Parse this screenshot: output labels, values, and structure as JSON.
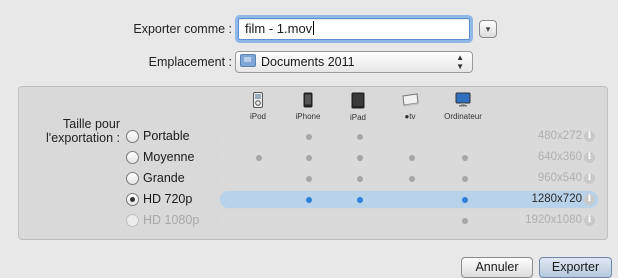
{
  "export_as": {
    "label": "Exporter comme :",
    "value": "film - 1.mov",
    "disclosure": "▾"
  },
  "location": {
    "label": "Emplacement :",
    "value": "Documents 2011",
    "folder_icon": "folder-icon"
  },
  "size": {
    "label_line1": "Taille pour",
    "label_line2": "l'exportation :",
    "devices": [
      {
        "name": "iPod",
        "icon": "ipod-icon"
      },
      {
        "name": "iPhone",
        "icon": "iphone-icon"
      },
      {
        "name": "iPad",
        "icon": "ipad-icon"
      },
      {
        "name": "tv",
        "icon": "appletv-icon"
      },
      {
        "name": "Ordinateur",
        "icon": "computer-icon"
      }
    ],
    "options": [
      {
        "label": "Portable",
        "resolution": "480x272",
        "selected": false,
        "enabled": true,
        "compat": [
          false,
          true,
          true,
          false,
          false
        ]
      },
      {
        "label": "Moyenne",
        "resolution": "640x360",
        "selected": false,
        "enabled": true,
        "compat": [
          true,
          true,
          true,
          true,
          true
        ]
      },
      {
        "label": "Grande",
        "resolution": "960x540",
        "selected": false,
        "enabled": true,
        "compat": [
          false,
          true,
          true,
          true,
          true
        ]
      },
      {
        "label": "HD 720p",
        "resolution": "1280x720",
        "selected": true,
        "enabled": true,
        "compat": [
          false,
          true,
          true,
          false,
          true
        ]
      },
      {
        "label": "HD 1080p",
        "resolution": "1920x1080",
        "selected": false,
        "enabled": false,
        "compat": [
          false,
          false,
          false,
          false,
          true
        ]
      }
    ]
  },
  "buttons": {
    "cancel": "Annuler",
    "export": "Exporter"
  },
  "colors": {
    "selected_row": "#b8d2ea",
    "accent_dot": "#2f7fdd"
  }
}
